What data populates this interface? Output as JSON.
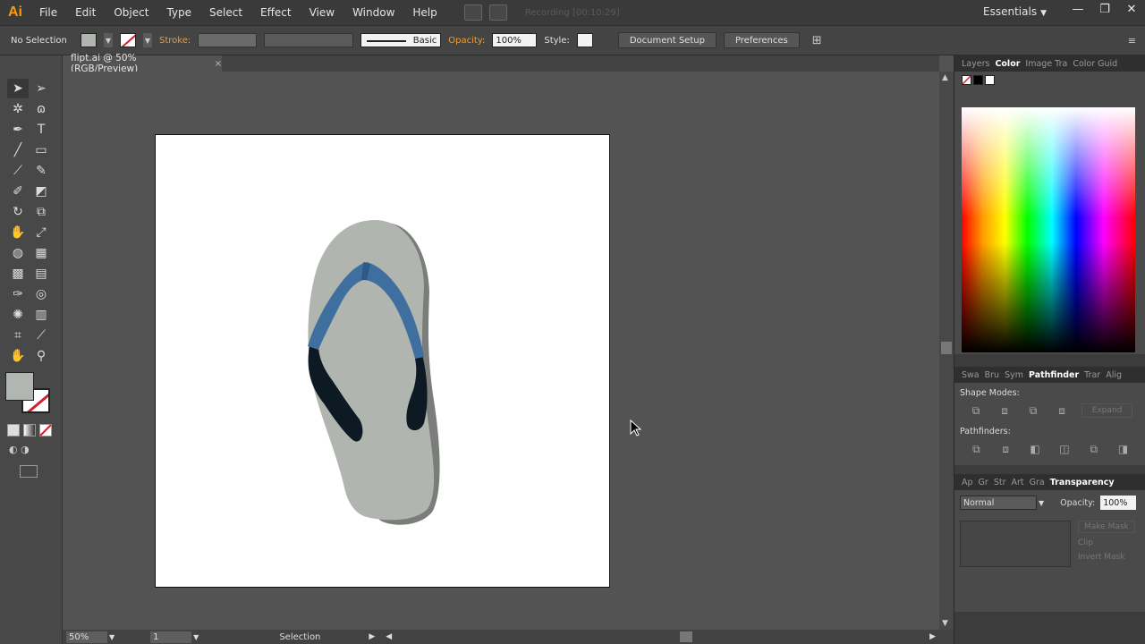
{
  "app": {
    "logo": "Ai",
    "menu": [
      "File",
      "Edit",
      "Object",
      "Type",
      "Select",
      "Effect",
      "View",
      "Window",
      "Help"
    ],
    "recording": "Recording [00:10:29]",
    "workspace": "Essentials",
    "window_controls": [
      "—",
      "❐",
      "✕"
    ]
  },
  "control_bar": {
    "selection": "No Selection",
    "stroke_label": "Stroke:",
    "brush_style": "Basic",
    "opacity_label": "Opacity:",
    "opacity_value": "100%",
    "style_label": "Style:",
    "document_setup": "Document Setup",
    "preferences": "Preferences"
  },
  "document": {
    "tab_title": "flipt.ai @ 50% (RGB/Preview)",
    "close": "×"
  },
  "status": {
    "zoom": "50%",
    "page": "1",
    "tool_name": "Selection"
  },
  "panels": {
    "color_tabs": [
      "Layers",
      "Color",
      "Image Tra",
      "Color Guid"
    ],
    "pathfinder_tabs": [
      "Swa",
      "Bru",
      "Sym",
      "Pathfinder",
      "Trar",
      "Alig"
    ],
    "shape_modes_label": "Shape Modes:",
    "expand": "Expand",
    "pathfinders_label": "Pathfinders:",
    "transparency_tabs": [
      "Ap",
      "Gr",
      "Str",
      "Art",
      "Gra",
      "Transparency"
    ],
    "blend_mode": "Normal",
    "opacity_label": "Opacity:",
    "opacity_value": "100%",
    "make_mask": "Make Mask",
    "clip": "Clip",
    "invert_mask": "Invert Mask"
  },
  "colors": {
    "sole": "#b1b5b0",
    "sole_shadow": "#7a7d79",
    "strap": "#3e6f9e",
    "strap_dark": "#0d1a24",
    "accent": "#ff9a00"
  },
  "icons": {
    "tools": [
      "selection-tool",
      "direct-selection-tool",
      "magic-wand-tool",
      "lasso-tool",
      "pen-tool",
      "type-tool",
      "line-tool",
      "rectangle-tool",
      "paintbrush-tool",
      "pencil-tool",
      "blob-brush-tool",
      "eraser-tool",
      "rotate-tool",
      "scale-tool",
      "warp-tool",
      "free-transform-tool",
      "shape-builder-tool",
      "perspective-grid-tool",
      "mesh-tool",
      "gradient-tool",
      "eyedropper-tool",
      "blend-tool",
      "symbol-sprayer-tool",
      "column-graph-tool",
      "artboard-tool",
      "slice-tool",
      "hand-tool",
      "zoom-tool"
    ]
  }
}
